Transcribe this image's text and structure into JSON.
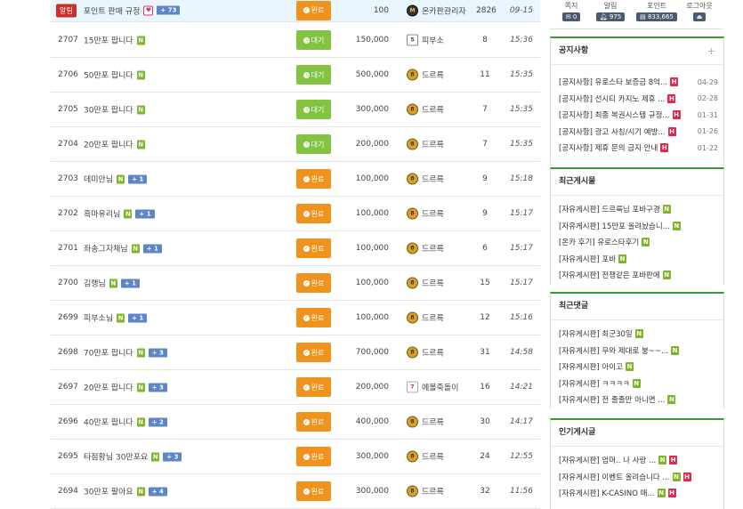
{
  "notice_row": {
    "tag": "알림",
    "subject": "포인트 판매 규정",
    "heart": "♥",
    "comments": "+ 73",
    "status": "완료",
    "points": "100",
    "author": "온카판관리자",
    "views": "2826",
    "date": "09-15"
  },
  "posts": [
    {
      "num": "2707",
      "subject": "15만포 팝니다",
      "new": "N",
      "comments": "",
      "status": "대기",
      "status_type": "wait",
      "points": "150,000",
      "author": "피부소",
      "level": "5",
      "views": "8",
      "date": "15:36"
    },
    {
      "num": "2706",
      "subject": "50만포 팝니다",
      "new": "N",
      "comments": "",
      "status": "대기",
      "status_type": "wait",
      "points": "500,000",
      "author": "드르륵",
      "level": "8",
      "views": "11",
      "date": "15:35"
    },
    {
      "num": "2705",
      "subject": "30만포 팝니다",
      "new": "N",
      "comments": "",
      "status": "대기",
      "status_type": "wait",
      "points": "300,000",
      "author": "드르륵",
      "level": "8",
      "views": "7",
      "date": "15:35"
    },
    {
      "num": "2704",
      "subject": "20만포 팝니다",
      "new": "N",
      "comments": "",
      "status": "대기",
      "status_type": "wait",
      "points": "200,000",
      "author": "드르륵",
      "level": "8",
      "views": "7",
      "date": "15:35"
    },
    {
      "num": "2703",
      "subject": "데미안님",
      "new": "N",
      "comments": "+ 1",
      "status": "완료",
      "status_type": "done",
      "points": "100,000",
      "author": "드르륵",
      "level": "8",
      "views": "9",
      "date": "15:18"
    },
    {
      "num": "2702",
      "subject": "흑마유리님",
      "new": "N",
      "comments": "+ 1",
      "status": "완료",
      "status_type": "done",
      "points": "100,000",
      "author": "드르륵",
      "level": "8",
      "views": "9",
      "date": "15:17"
    },
    {
      "num": "2701",
      "subject": "좌송그자체님",
      "new": "N",
      "comments": "+ 1",
      "status": "완료",
      "status_type": "done",
      "points": "100,000",
      "author": "드르륵",
      "level": "8",
      "views": "6",
      "date": "15:17"
    },
    {
      "num": "2700",
      "subject": "김행님",
      "new": "N",
      "comments": "+ 1",
      "status": "완료",
      "status_type": "done",
      "points": "100,000",
      "author": "드르륵",
      "level": "8",
      "views": "15",
      "date": "15:17"
    },
    {
      "num": "2699",
      "subject": "피부소님",
      "new": "N",
      "comments": "+ 1",
      "status": "완료",
      "status_type": "done",
      "points": "100,000",
      "author": "드르륵",
      "level": "8",
      "views": "12",
      "date": "15:16"
    },
    {
      "num": "2698",
      "subject": "70만포 팝니다",
      "new": "N",
      "comments": "+ 3",
      "status": "완료",
      "status_type": "done",
      "points": "700,000",
      "author": "드르륵",
      "level": "8",
      "views": "31",
      "date": "14:58"
    },
    {
      "num": "2697",
      "subject": "20만포 팝니다",
      "new": "N",
      "comments": "+ 3",
      "status": "완료",
      "status_type": "done",
      "points": "200,000",
      "author": "에볼죽돌이",
      "level": "7",
      "views": "16",
      "date": "14:21"
    },
    {
      "num": "2696",
      "subject": "40만포 팝니다",
      "new": "N",
      "comments": "+ 2",
      "status": "완료",
      "status_type": "done",
      "points": "400,000",
      "author": "드르륵",
      "level": "8",
      "views": "30",
      "date": "14:17"
    },
    {
      "num": "2695",
      "subject": "타점황님 30만포요",
      "new": "N",
      "comments": "+ 3",
      "status": "완료",
      "status_type": "done",
      "points": "300,000",
      "author": "드르륵",
      "level": "8",
      "views": "24",
      "date": "12:55"
    },
    {
      "num": "2694",
      "subject": "30만포 팔아요",
      "new": "N",
      "comments": "+ 4",
      "status": "완료",
      "status_type": "done",
      "points": "300,000",
      "author": "드르륵",
      "level": "8",
      "views": "32",
      "date": "11:56"
    }
  ],
  "user_box": {
    "message_label": "쪽지",
    "message_count": "0",
    "alarm_label": "알림",
    "alarm_count": "975",
    "point_label": "포인트",
    "point_value": "833,665",
    "logout_label": "로그아웃"
  },
  "notices_panel": {
    "title": "공지사항",
    "plus": "+",
    "items": [
      {
        "text": "[공지사항] 유로스타 보증금 8억...",
        "date": "04-29"
      },
      {
        "text": "[공지사항] 선시티 카지노 제휴 ...",
        "date": "02-28"
      },
      {
        "text": "[공지사항] 최종 복권시스템 규정...",
        "date": "01-31"
      },
      {
        "text": "[공지사항] 광고 사칭/시기 예방...",
        "date": "01-26"
      },
      {
        "text": "[공지사항] 제휴 문의 금지 안내",
        "date": "01-22"
      }
    ]
  },
  "recent_posts_panel": {
    "title": "최근게시물",
    "items": [
      {
        "text": "[자유게시판] 드르륵님 포바구경"
      },
      {
        "text": "[자유게시판] 15만포 올려놨습니..."
      },
      {
        "text": "[온카 후기] 유로스타후기"
      },
      {
        "text": "[자유게시판] 포바"
      },
      {
        "text": "[자유게시판] 전쟁같은 포바판에"
      }
    ]
  },
  "recent_comments_panel": {
    "title": "최근댓글",
    "items": [
      {
        "text": "[자유게시판] 최군30일"
      },
      {
        "text": "[자유게시판] 우와 제대로 붕~~..."
      },
      {
        "text": "[자유게시판] 아이고"
      },
      {
        "text": "[자유게시판] ㅋㅋㅋㅋ"
      },
      {
        "text": "[자유게시판] 전 졸졸만 아니면 ..."
      }
    ]
  },
  "popular_panel": {
    "title": "인기게시글",
    "items": [
      {
        "text": "[자유게시판] 엄머.. 나 사랑 ..."
      },
      {
        "text": "[자유게시판] 이벤트 올려습니다 ..."
      },
      {
        "text": "[자유게시판] K-CASINO 매..."
      }
    ]
  },
  "badge_new": "N",
  "badge_hot": "H"
}
